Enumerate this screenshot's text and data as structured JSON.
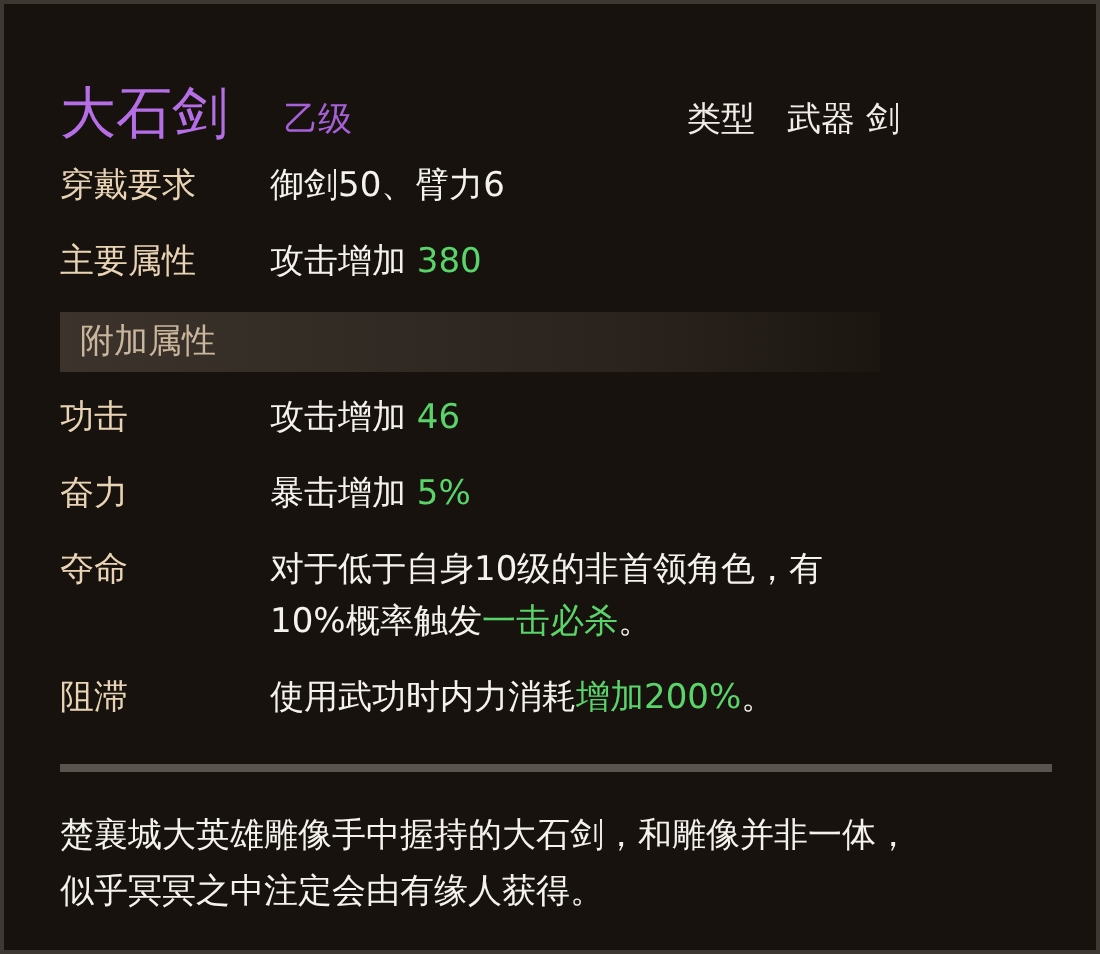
{
  "item": {
    "name": "大石剑",
    "grade": "乙级",
    "type_label": "类型",
    "type_value": "武器 剑"
  },
  "base_rows": [
    {
      "label": "穿戴要求",
      "segments": [
        {
          "text": "御剑50、臂力6",
          "highlight": false
        }
      ]
    },
    {
      "label": "主要属性",
      "segments": [
        {
          "text": "攻击增加 ",
          "highlight": false
        },
        {
          "text": "380",
          "highlight": true
        }
      ]
    }
  ],
  "extra_section": {
    "title": "附加属性"
  },
  "extra_rows": [
    {
      "label": "功击",
      "segments": [
        {
          "text": "攻击增加 ",
          "highlight": false
        },
        {
          "text": "46",
          "highlight": true
        }
      ]
    },
    {
      "label": "奋力",
      "segments": [
        {
          "text": "暴击增加 ",
          "highlight": false
        },
        {
          "text": "5%",
          "highlight": true
        }
      ]
    },
    {
      "label": "夺命",
      "segments": [
        {
          "text": "对于低于自身10级的非首领角色，有10%概率触发",
          "highlight": false
        },
        {
          "text": "一击必杀",
          "highlight": true
        },
        {
          "text": "。",
          "highlight": false
        }
      ]
    },
    {
      "label": "阻滞",
      "segments": [
        {
          "text": "使用武功时内力消耗",
          "highlight": false
        },
        {
          "text": "增加200%",
          "highlight": true
        },
        {
          "text": "。",
          "highlight": false
        }
      ]
    }
  ],
  "description": "楚襄城大英雄雕像手中握持的大石剑，和雕像并非一体，似乎冥冥之中注定会由有缘人获得。"
}
